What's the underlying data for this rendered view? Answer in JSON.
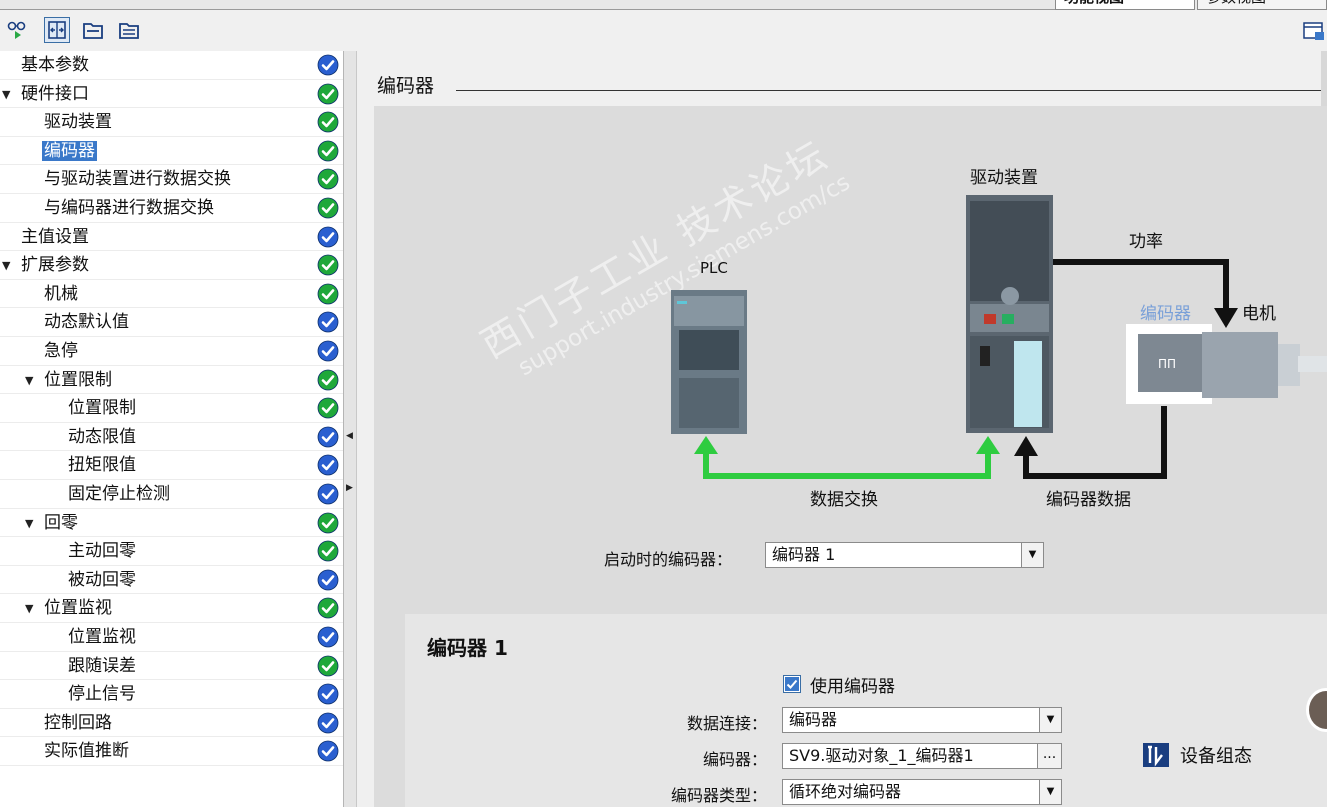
{
  "top_tabs": {
    "active": "功能视图",
    "inactive": "参数视图"
  },
  "toolbar": {
    "icons": [
      "view-glasses-icon",
      "expand-split-icon",
      "folder-collapse-icon",
      "folder-expand-icon",
      "panel-toggle-icon"
    ]
  },
  "tree": [
    {
      "label": "基本参数",
      "level": 0,
      "toggle": "",
      "status": "blue"
    },
    {
      "label": "硬件接口",
      "level": 0,
      "toggle": "▼",
      "status": "green"
    },
    {
      "label": "驱动装置",
      "level": 1,
      "toggle": "",
      "status": "green"
    },
    {
      "label": "编码器",
      "level": 1,
      "toggle": "",
      "status": "green",
      "selected": true
    },
    {
      "label": "与驱动装置进行数据交换",
      "level": 1,
      "toggle": "",
      "status": "green"
    },
    {
      "label": "与编码器进行数据交换",
      "level": 1,
      "toggle": "",
      "status": "green"
    },
    {
      "label": "主值设置",
      "level": 0,
      "toggle": "",
      "status": "blue"
    },
    {
      "label": "扩展参数",
      "level": 0,
      "toggle": "▼",
      "status": "green"
    },
    {
      "label": "机械",
      "level": 1,
      "toggle": "",
      "status": "green"
    },
    {
      "label": "动态默认值",
      "level": 1,
      "toggle": "",
      "status": "blue"
    },
    {
      "label": "急停",
      "level": 1,
      "toggle": "",
      "status": "blue"
    },
    {
      "label": "位置限制",
      "level": 1,
      "toggle": "▼",
      "status": "green"
    },
    {
      "label": "位置限制",
      "level": 2,
      "toggle": "",
      "status": "green"
    },
    {
      "label": "动态限值",
      "level": 2,
      "toggle": "",
      "status": "blue"
    },
    {
      "label": "扭矩限值",
      "level": 2,
      "toggle": "",
      "status": "blue"
    },
    {
      "label": "固定停止检测",
      "level": 2,
      "toggle": "",
      "status": "blue"
    },
    {
      "label": "回零",
      "level": 1,
      "toggle": "▼",
      "status": "green"
    },
    {
      "label": "主动回零",
      "level": 2,
      "toggle": "",
      "status": "green"
    },
    {
      "label": "被动回零",
      "level": 2,
      "toggle": "",
      "status": "blue"
    },
    {
      "label": "位置监视",
      "level": 1,
      "toggle": "▼",
      "status": "green"
    },
    {
      "label": "位置监视",
      "level": 2,
      "toggle": "",
      "status": "blue"
    },
    {
      "label": "跟随误差",
      "level": 2,
      "toggle": "",
      "status": "green"
    },
    {
      "label": "停止信号",
      "level": 2,
      "toggle": "",
      "status": "blue"
    },
    {
      "label": "控制回路",
      "level": 1,
      "toggle": "",
      "status": "blue"
    },
    {
      "label": "实际值推断",
      "level": 1,
      "toggle": "",
      "status": "blue"
    }
  ],
  "status_colors": {
    "green": "#1fa83a",
    "blue": "#2a5fd0"
  },
  "section": {
    "title": "编码器"
  },
  "diagram": {
    "plc_label": "PLC",
    "drive_label": "驱动装置",
    "power_label": "功率",
    "encoder_label": "编码器",
    "motor_label": "电机",
    "data_exchange_label": "数据交换",
    "encoder_data_label": "编码器数据",
    "watermark_cn": "西门子工业 技术论坛",
    "watermark_url": "support.industry.siemens.com/cs",
    "arrow_green": "#2ecc40",
    "arrow_black": "#111111"
  },
  "startup_encoder": {
    "label": "启动时的编码器：",
    "value": "编码器 1"
  },
  "encoder1": {
    "title": "编码器 1",
    "use_encoder_label": "使用编码器",
    "use_encoder_checked": true,
    "data_connection_label": "数据连接：",
    "data_connection_value": "编码器",
    "encoder_label": "编码器：",
    "encoder_value": "SV9.驱动对象_1_编码器1",
    "encoder_type_label": "编码器类型：",
    "encoder_type_value": "循环绝对编码器",
    "device_config_label": "设备组态"
  }
}
